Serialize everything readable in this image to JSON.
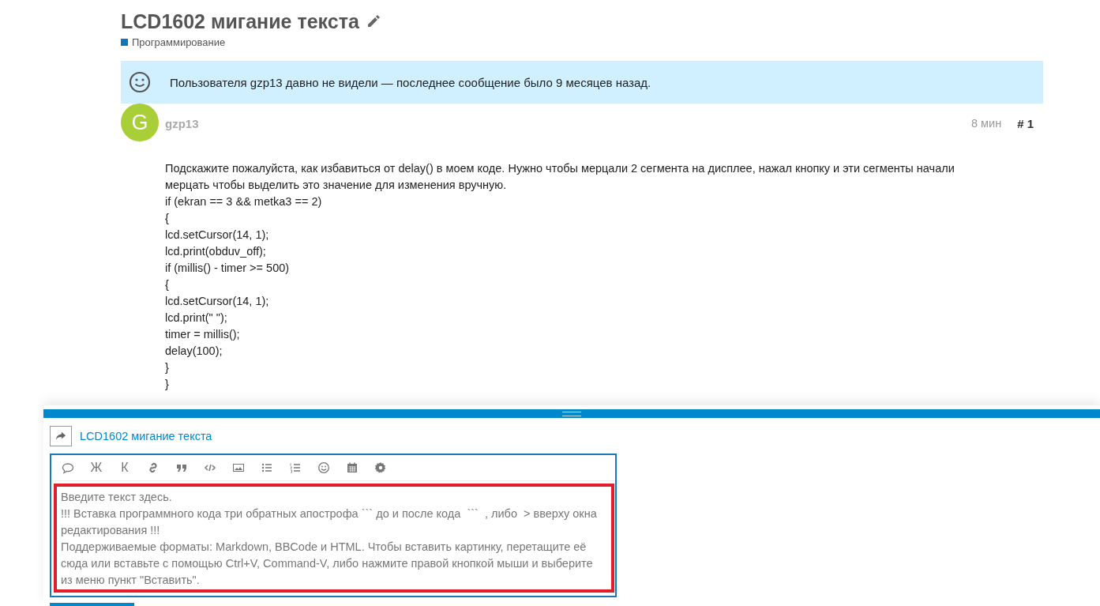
{
  "topic": {
    "title": "LCD1602 мигание текста",
    "category": {
      "name": "Программирование",
      "color": "#0e76bd"
    }
  },
  "notice": {
    "text": "Пользователя gzp13 давно не видели — последнее сообщение было 9 месяцев назад."
  },
  "post": {
    "avatar_letter": "G",
    "username": "gzp13",
    "time": "8 мин",
    "number": "# 1",
    "lines": [
      "Подскажите пожалуйста, как избавиться от delay() в моем коде. Нужно чтобы мерцали 2 сегмента на дисплее, нажал кнопку и эти сегменты начали мерцать чтобы выделить это значение для изменения вручную.",
      "if (ekran == 3 && metka3 == 2)",
      "{",
      "lcd.setCursor(14, 1);",
      "lcd.print(obduv_off);",
      "if (millis() - timer >= 500)",
      "{",
      "lcd.setCursor(14, 1);",
      "lcd.print(\" \");",
      "timer = millis();",
      "delay(100);",
      "}",
      "}"
    ]
  },
  "composer": {
    "reply_to": "LCD1602 мигание текста",
    "toolbar": [
      {
        "kind": "quote"
      },
      {
        "kind": "text",
        "label": "Ж"
      },
      {
        "kind": "text",
        "label": "К"
      },
      {
        "kind": "link"
      },
      {
        "kind": "blockquote"
      },
      {
        "kind": "code"
      },
      {
        "kind": "image"
      },
      {
        "kind": "bullets"
      },
      {
        "kind": "numbers"
      },
      {
        "kind": "emoji"
      },
      {
        "kind": "calendar"
      },
      {
        "kind": "settings"
      }
    ],
    "placeholder": "Введите текст здесь.\n!!! Вставка программного кода три обратных апострофа ``` до и после кода  ```  , либо  > вверху окна редактирования !!!\nПоддерживаемые форматы: Markdown, BBCode и HTML. Чтобы вставить картинку, перетащите её сюда или вставьте с помощью Ctrl+V, Command-V, либо нажмите правой кнопкой мыши и выберите из меню пункт \"Вставить\"."
  }
}
